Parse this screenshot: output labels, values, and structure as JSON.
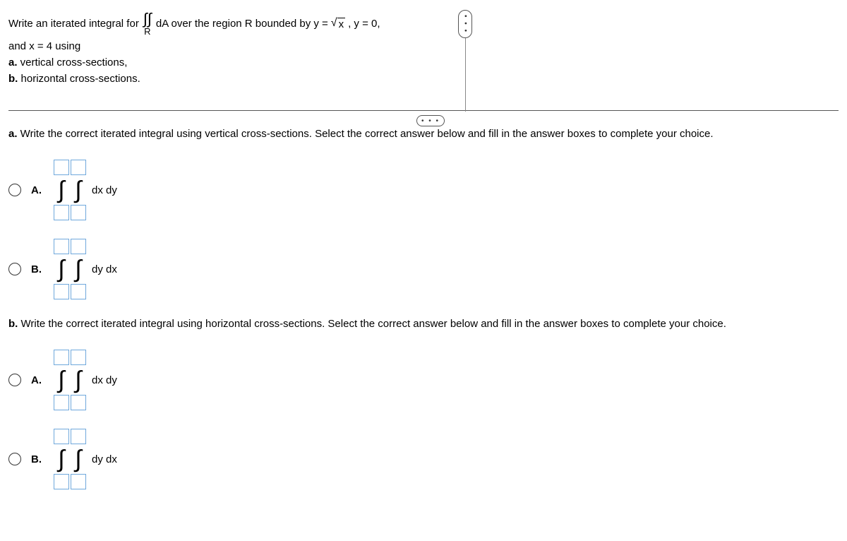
{
  "question": {
    "line1_prefix": "Write an iterated integral for",
    "integral_label": "∫∫",
    "integral_sub": "R",
    "line1_after_integral": "dA over the region R bounded by y =",
    "sqrt_radicand": "x",
    "line1_suffix": ", y = 0,",
    "line2": "and x = 4 using",
    "line3": "a. vertical cross-sections,",
    "line3_prefix_bold": "a.",
    "line3_rest": " vertical cross-sections,",
    "line4_prefix_bold": "b.",
    "line4_rest": " horizontal cross-sections."
  },
  "more_label": "• • •",
  "scroll_label": "• • •",
  "part_a": {
    "instruction_bold": "a.",
    "instruction_rest": " Write the correct iterated integral using vertical cross-sections. Select the correct answer below and fill in the answer boxes to complete your choice.",
    "choices": {
      "A": {
        "label": "A.",
        "diff": "dx dy"
      },
      "B": {
        "label": "B.",
        "diff": "dy dx"
      }
    }
  },
  "part_b": {
    "instruction_bold": "b.",
    "instruction_rest": " Write the correct iterated integral using horizontal cross-sections. Select the correct answer below and fill in the answer boxes to complete your choice.",
    "choices": {
      "A": {
        "label": "A.",
        "diff": "dx dy"
      },
      "B": {
        "label": "B.",
        "diff": "dy dx"
      }
    }
  }
}
